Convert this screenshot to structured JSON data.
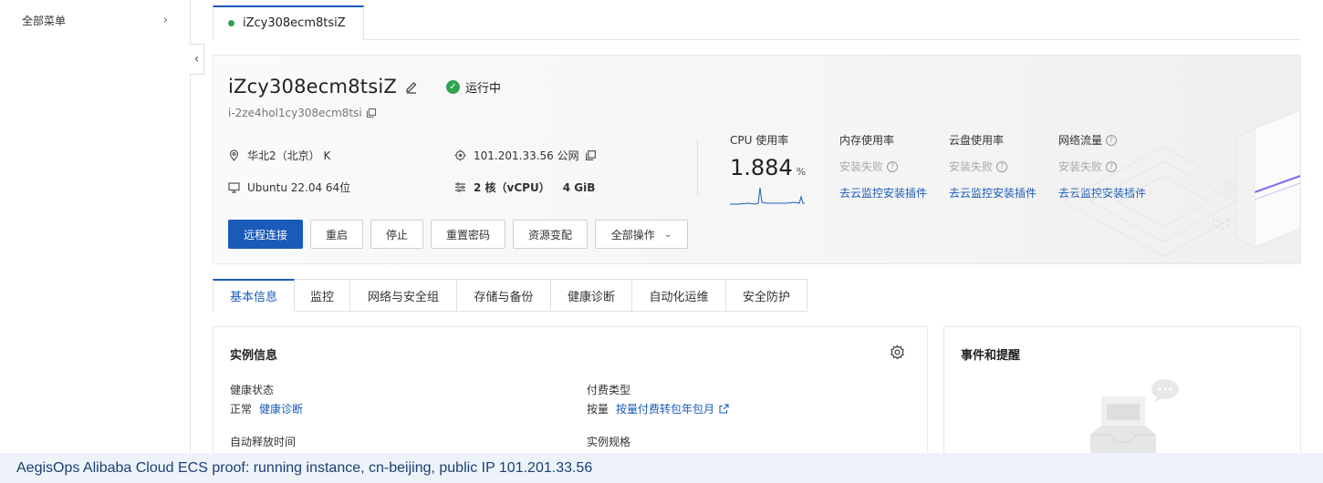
{
  "sidebar": {
    "menu_label": "全部菜单",
    "menu_chevron": "›"
  },
  "collapse": {
    "glyph": "‹"
  },
  "top_tab": {
    "label": "iZcy308ecm8tsiZ"
  },
  "instance": {
    "name": "iZcy308ecm8tsiZ",
    "status": "运行中",
    "id": "i-2ze4hol1cy308ecm8tsi",
    "region": "华北2（北京） K",
    "public_ip": "101.201.33.56 公网",
    "os": "Ubuntu 22.04 64位",
    "cpu_spec": "2 核（vCPU）",
    "mem_spec": "4 GiB"
  },
  "actions": {
    "remote": "远程连接",
    "restart": "重启",
    "stop": "停止",
    "reset_password": "重置密码",
    "resize": "资源变配",
    "all_ops": "全部操作"
  },
  "metrics": {
    "cpu_label": "CPU 使用率",
    "cpu_value": "1.884",
    "cpu_unit": "%",
    "mem_label": "内存使用率",
    "disk_label": "云盘使用率",
    "net_label": "网络流量",
    "fail_text": "安装失败",
    "install_link": "去云监控安装插件"
  },
  "tabs": [
    {
      "label": "基本信息"
    },
    {
      "label": "监控"
    },
    {
      "label": "网络与安全组"
    },
    {
      "label": "存储与备份"
    },
    {
      "label": "健康诊断"
    },
    {
      "label": "自动化运维"
    },
    {
      "label": "安全防护"
    }
  ],
  "instance_info": {
    "title": "实例信息",
    "health_label": "健康状态",
    "health_value": "正常",
    "health_link": "健康诊断",
    "billing_label": "付费类型",
    "billing_value": "按量",
    "billing_link": "按量付费转包年包月",
    "release_label": "自动释放时间",
    "spec_label": "实例规格"
  },
  "events": {
    "title": "事件和提醒"
  },
  "caption": "AegisOps Alibaba Cloud ECS proof: running instance, cn-beijing, public IP 101.201.33.56",
  "colors": {
    "primary": "#1a5ab8",
    "running": "#2ea44f"
  }
}
